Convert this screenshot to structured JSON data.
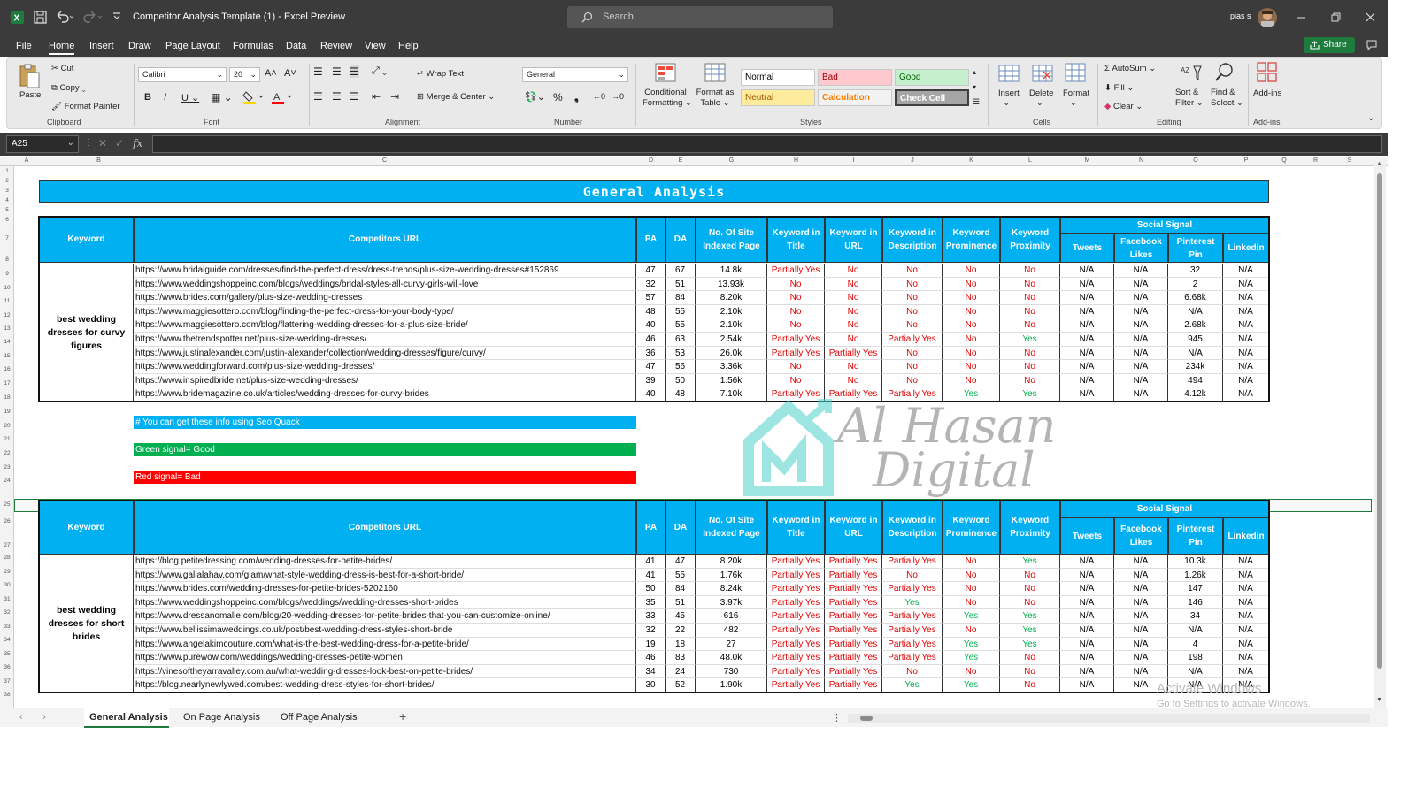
{
  "window": {
    "title": "Competitor Analysis Template (1)  -  Excel Preview",
    "search_placeholder": "Search",
    "user": "pias s"
  },
  "menu": [
    "File",
    "Home",
    "Insert",
    "Draw",
    "Page Layout",
    "Formulas",
    "Data",
    "Review",
    "View",
    "Help"
  ],
  "active_menu": "Home",
  "share_label": "Share",
  "ribbon": {
    "clipboard": {
      "paste": "Paste",
      "cut": "Cut",
      "copy": "Copy",
      "format_painter": "Format Painter",
      "group": "Clipboard"
    },
    "font": {
      "name": "Calibri",
      "size": "20",
      "group": "Font"
    },
    "alignment": {
      "wrap": "Wrap Text",
      "merge": "Merge & Center",
      "group": "Alignment"
    },
    "number": {
      "format": "General",
      "group": "Number"
    },
    "styles": {
      "conditional": "Conditional",
      "conditional2": "Formatting",
      "format_as": "Format as",
      "format_as2": "Table",
      "normal": "Normal",
      "bad": "Bad",
      "good": "Good",
      "neutral": "Neutral",
      "calculation": "Calculation",
      "check_cell": "Check Cell",
      "group": "Styles"
    },
    "cells": {
      "insert": "Insert",
      "delete": "Delete",
      "format": "Format",
      "group": "Cells"
    },
    "editing": {
      "autosum": "AutoSum",
      "fill": "Fill",
      "clear": "Clear",
      "sort": "Sort &",
      "sort2": "Filter",
      "find": "Find &",
      "find2": "Select",
      "group": "Editing"
    },
    "addins": {
      "label": "Add-ins",
      "group": "Add-ins"
    }
  },
  "formula_bar": {
    "name_box": "A25",
    "fx": "fx",
    "value": ""
  },
  "columns": [
    "A",
    "B",
    "C",
    "D",
    "E",
    "G",
    "H",
    "I",
    "J",
    "K",
    "L",
    "M",
    "N",
    "O",
    "P",
    "Q",
    "R",
    "S"
  ],
  "rows": [
    "1",
    "2",
    "3",
    "4",
    "5",
    "6",
    "7",
    "8",
    "9",
    "10",
    "11",
    "12",
    "13",
    "14",
    "15",
    "16",
    "17",
    "18",
    "19",
    "20",
    "21",
    "22",
    "23",
    "24",
    "25",
    "26",
    "27",
    "28",
    "29",
    "30",
    "31",
    "32",
    "33",
    "34",
    "35",
    "36",
    "37",
    "38"
  ],
  "banner": "General Analysis",
  "headers": {
    "keyword": "Keyword",
    "url": "Competitors URL",
    "pa": "PA",
    "da": "DA",
    "indexed": "No. Of Site Indexed Page",
    "kw_title": "Keyword in Title",
    "kw_url": "Keyword in URL",
    "kw_desc": "Keyword in Description",
    "prominence": "Keyword Prominence",
    "proximity": "Keyword Proximity",
    "social": "Social Signal",
    "tweets": "Tweets",
    "fb": "Facebook Likes",
    "pin": "Pinterest Pin",
    "li": "Linkedin"
  },
  "table1": {
    "keyword": "best wedding dresses for curvy figures",
    "rows": [
      [
        "https://www.bridalguide.com/dresses/find-the-perfect-dress/dress-trends/plus-size-wedding-dresses#152869",
        "47",
        "67",
        "14.8k",
        "Partially Yes",
        "No",
        "No",
        "No",
        "No",
        "N/A",
        "N/A",
        "32",
        "N/A"
      ],
      [
        "https://www.weddingshoppeinc.com/blogs/weddings/bridal-styles-all-curvy-girls-will-love",
        "32",
        "51",
        "13.93k",
        "No",
        "No",
        "No",
        "No",
        "No",
        "N/A",
        "N/A",
        "2",
        "N/A"
      ],
      [
        "https://www.brides.com/gallery/plus-size-wedding-dresses",
        "57",
        "84",
        "8.20k",
        "No",
        "No",
        "No",
        "No",
        "No",
        "N/A",
        "N/A",
        "6.68k",
        "N/A"
      ],
      [
        "https://www.maggiesottero.com/blog/finding-the-perfect-dress-for-your-body-type/",
        "48",
        "55",
        "2.10k",
        "No",
        "No",
        "No",
        "No",
        "No",
        "N/A",
        "N/A",
        "N/A",
        "N/A"
      ],
      [
        "https://www.maggiesottero.com/blog/flattering-wedding-dresses-for-a-plus-size-bride/",
        "40",
        "55",
        "2.10k",
        "No",
        "No",
        "No",
        "No",
        "No",
        "N/A",
        "N/A",
        "2.68k",
        "N/A"
      ],
      [
        "https://www.thetrendspotter.net/plus-size-wedding-dresses/",
        "46",
        "63",
        "2.54k",
        "Partially Yes",
        "No",
        "Partially Yes",
        "No",
        "Yes",
        "N/A",
        "N/A",
        "945",
        "N/A"
      ],
      [
        "https://www.justinalexander.com/justin-alexander/collection/wedding-dresses/figure/curvy/",
        "36",
        "53",
        "26.0k",
        "Partially Yes",
        "Partially Yes",
        "No",
        "No",
        "No",
        "N/A",
        "N/A",
        "N/A",
        "N/A"
      ],
      [
        "https://www.weddingforward.com/plus-size-wedding-dresses/",
        "47",
        "56",
        "3.36k",
        "No",
        "No",
        "No",
        "No",
        "No",
        "N/A",
        "N/A",
        "234k",
        "N/A"
      ],
      [
        "https://www.inspiredbride.net/plus-size-wedding-dresses/",
        "39",
        "50",
        "1.56k",
        "No",
        "No",
        "No",
        "No",
        "No",
        "N/A",
        "N/A",
        "494",
        "N/A"
      ],
      [
        "https://www.bridemagazine.co.uk/articles/wedding-dresses-for-curvy-brides",
        "40",
        "48",
        "7.10k",
        "Partially Yes",
        "Partially Yes",
        "Partially Yes",
        "Yes",
        "Yes",
        "N/A",
        "N/A",
        "4.12k",
        "N/A"
      ]
    ]
  },
  "notes": {
    "seo": "# You can get these info using Seo Quack",
    "green": "Green signal= Good",
    "red": "Red signal= Bad"
  },
  "table2": {
    "keyword": "best wedding dresses for short brides",
    "rows": [
      [
        "https://blog.petitedressing.com/wedding-dresses-for-petite-brides/",
        "41",
        "47",
        "8.20k",
        "Partially Yes",
        "Partially Yes",
        "Partially Yes",
        "No",
        "Yes",
        "N/A",
        "N/A",
        "10.3k",
        "N/A"
      ],
      [
        "https://www.galialahav.com/glam/what-style-wedding-dress-is-best-for-a-short-bride/",
        "41",
        "55",
        "1.76k",
        "Partially Yes",
        "Partially Yes",
        "No",
        "No",
        "No",
        "N/A",
        "N/A",
        "1.26k",
        "N/A"
      ],
      [
        "https://www.brides.com/wedding-dresses-for-petite-brides-5202160",
        "50",
        "84",
        "8.24k",
        "Partially Yes",
        "Partially Yes",
        "Partially Yes",
        "No",
        "No",
        "N/A",
        "N/A",
        "147",
        "N/A"
      ],
      [
        "https://www.weddingshoppeinc.com/blogs/weddings/wedding-dresses-short-brides",
        "35",
        "51",
        "3.97k",
        "Partially Yes",
        "Partially Yes",
        "Yes",
        "No",
        "No",
        "N/A",
        "N/A",
        "146",
        "N/A"
      ],
      [
        "https://www.dressanomalie.com/blog/20-wedding-dresses-for-petite-brides-that-you-can-customize-online/",
        "33",
        "45",
        "616",
        "Partially Yes",
        "Partially Yes",
        "Partially Yes",
        "Yes",
        "Yes",
        "N/A",
        "N/A",
        "34",
        "N/A"
      ],
      [
        "https://www.bellissimaweddings.co.uk/post/best-wedding-dress-styles-short-bride",
        "32",
        "22",
        "482",
        "Partially Yes",
        "Partially Yes",
        "Partially Yes",
        "No",
        "Yes",
        "N/A",
        "N/A",
        "N/A",
        "N/A"
      ],
      [
        "https://www.angelakimcouture.com/what-is-the-best-wedding-dress-for-a-petite-bride/",
        "19",
        "18",
        "27",
        "Partially Yes",
        "Partially Yes",
        "Partially Yes",
        "Yes",
        "Yes",
        "N/A",
        "N/A",
        "4",
        "N/A"
      ],
      [
        "https://www.purewow.com/weddings/wedding-dresses-petite-women",
        "46",
        "83",
        "48.0k",
        "Partially Yes",
        "Partially Yes",
        "Partially Yes",
        "Yes",
        "No",
        "N/A",
        "N/A",
        "198",
        "N/A"
      ],
      [
        "https://vinesoftheyarravalley.com.au/what-wedding-dresses-look-best-on-petite-brides/",
        "34",
        "24",
        "730",
        "Partially Yes",
        "Partially Yes",
        "No",
        "No",
        "No",
        "N/A",
        "N/A",
        "N/A",
        "N/A"
      ],
      [
        "https://blog.nearlynewlywed.com/best-wedding-dress-styles-for-short-brides/",
        "30",
        "52",
        "1.90k",
        "Partially Yes",
        "Partially Yes",
        "Yes",
        "Yes",
        "No",
        "N/A",
        "N/A",
        "N/A",
        "N/A"
      ]
    ]
  },
  "watermark": {
    "line1": "Al Hasan",
    "line2": "Digital"
  },
  "activate": {
    "line1": "Activate Windows",
    "line2": "Go to Settings to activate Windows."
  },
  "sheet_tabs": [
    "General Analysis",
    "On Page Analysis",
    "Off Page Analysis"
  ],
  "active_tab": "General Analysis",
  "colors": {
    "header_blue": "#00b0f0",
    "good_green": "#00b050",
    "bad_red": "#ff0000",
    "excel_green": "#1e7b3e"
  }
}
